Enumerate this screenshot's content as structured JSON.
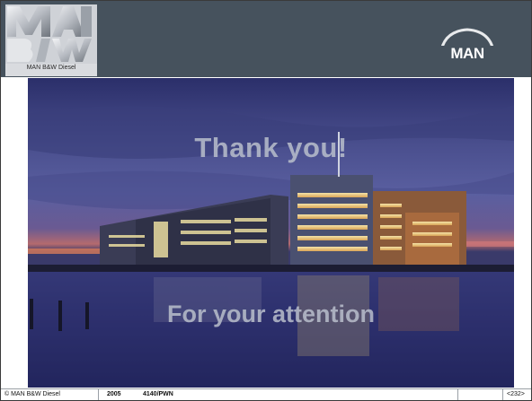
{
  "header": {
    "logo_caption": "MAN B&W Diesel",
    "logo_lettering": "MAN B&W",
    "badge_text": "MAN",
    "background_color": "#46525d"
  },
  "slide": {
    "headline": "Thank you!",
    "subline": "For your attention"
  },
  "footer": {
    "copyright": "© MAN B&W Diesel",
    "year": "2005",
    "code": "4140/PWN",
    "page": "<232>"
  }
}
